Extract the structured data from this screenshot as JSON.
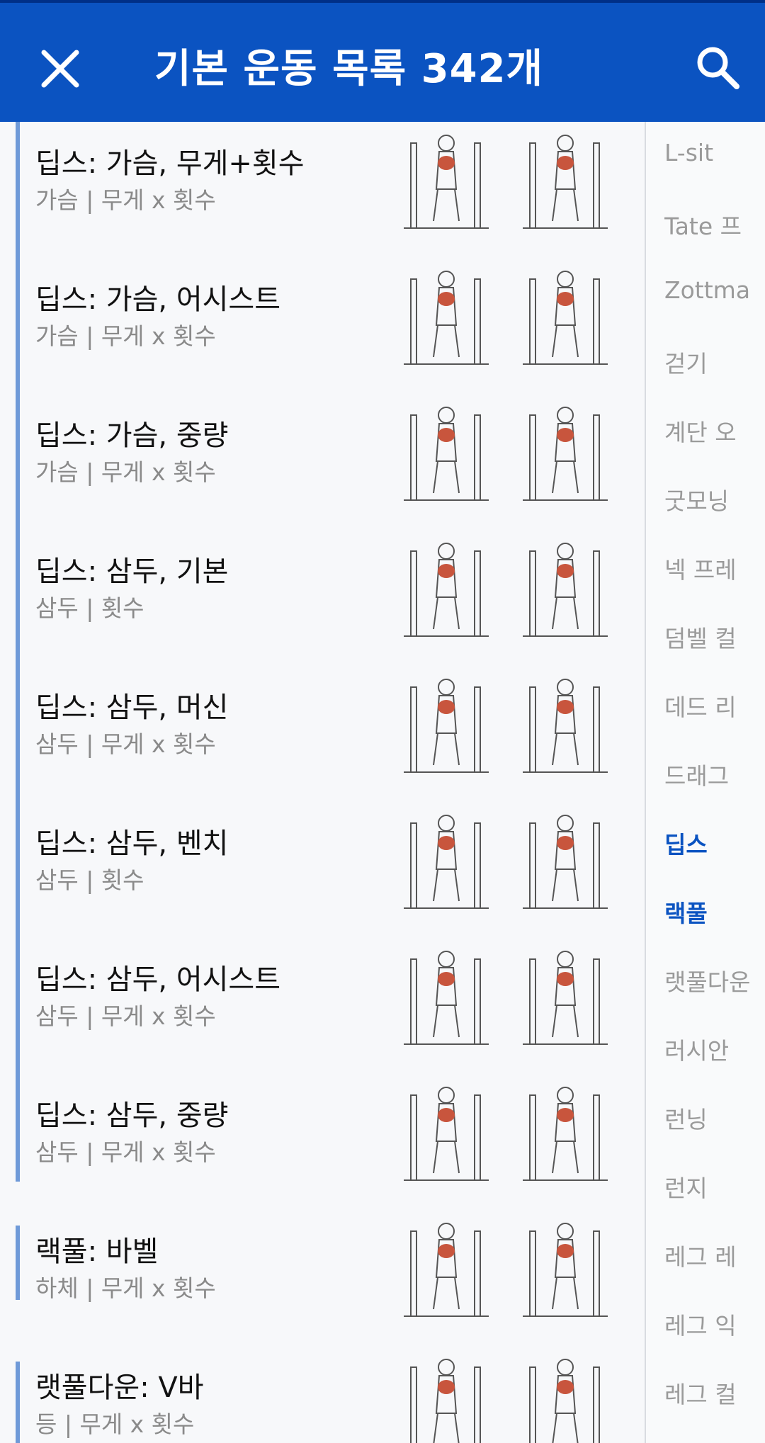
{
  "header": {
    "title": "기본 운동 목록 342개",
    "close_icon": "close-icon",
    "search_icon": "search-icon",
    "bg_color": "#0b53c1"
  },
  "exercises": [
    {
      "name": "딥스: 가슴, 무게+횟수",
      "meta": "가슴 | 무게 x 횟수"
    },
    {
      "name": "딥스: 가슴, 어시스트",
      "meta": "가슴 | 무게 x 횟수"
    },
    {
      "name": "딥스: 가슴, 중량",
      "meta": "가슴 | 무게 x 횟수"
    },
    {
      "name": "딥스: 삼두, 기본",
      "meta": "삼두 | 횟수"
    },
    {
      "name": "딥스: 삼두, 머신",
      "meta": "삼두 | 무게 x 횟수"
    },
    {
      "name": "딥스: 삼두, 벤치",
      "meta": "삼두 | 횟수"
    },
    {
      "name": "딥스: 삼두, 어시스트",
      "meta": "삼두 | 무게 x 횟수"
    },
    {
      "name": "딥스: 삼두, 중량",
      "meta": "삼두 | 무게 x 횟수"
    },
    {
      "name": "랙풀: 바벨",
      "meta": "하체 | 무게 x 횟수"
    },
    {
      "name": "랫풀다운: V바",
      "meta": "등 | 무게 x 횟수"
    }
  ],
  "index": {
    "items": [
      "L-sit",
      "Tate 프",
      "Zottma",
      "걷기",
      "계단 오",
      "굿모닝",
      "넥 프레",
      "덤벨 컬",
      "데드 리",
      "드래그",
      "딥스",
      "랙풀",
      "랫풀다운",
      "러시안",
      "런닝",
      "런지",
      "레그 레",
      "레그 익",
      "레그 컬"
    ],
    "active": [
      "딥스",
      "랙풀"
    ],
    "active_color": "#0b53c1"
  }
}
